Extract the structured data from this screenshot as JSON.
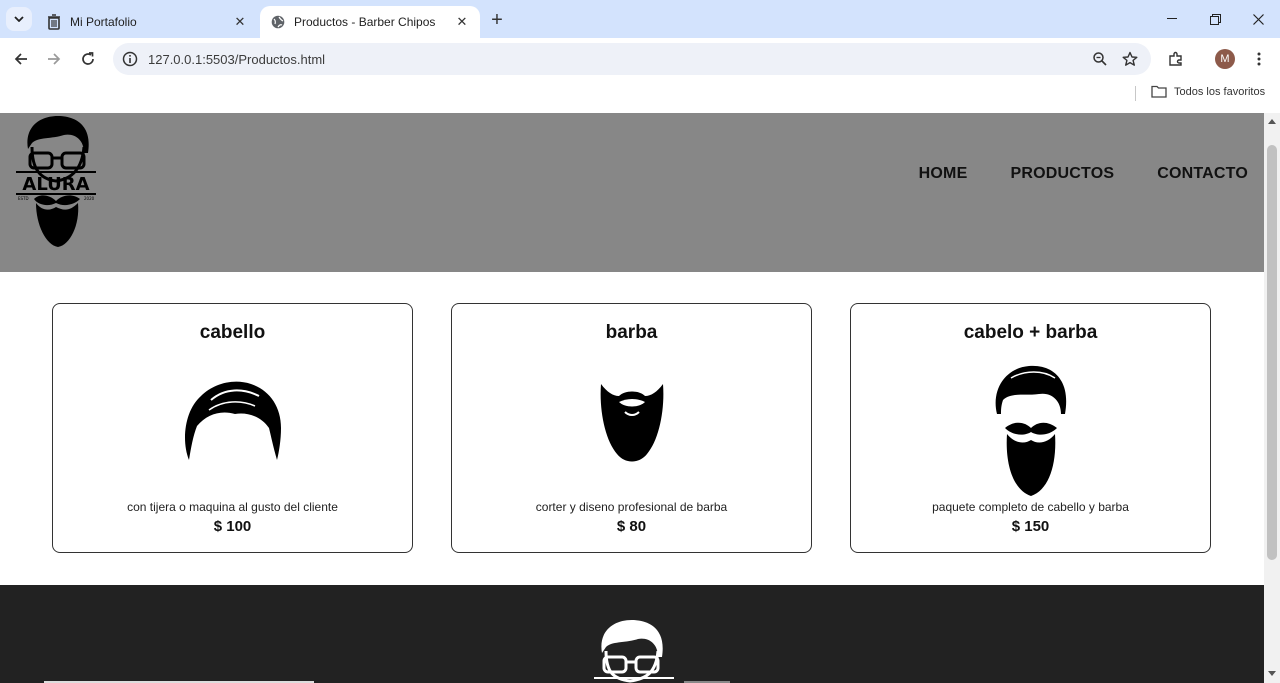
{
  "browser": {
    "tabs": [
      {
        "title": "Mi Portafolio",
        "active": false,
        "icon": "trash-icon"
      },
      {
        "title": "Productos - Barber Chipos",
        "active": true,
        "icon": "globe-icon"
      }
    ],
    "url": "127.0.0.1:5503/Productos.html",
    "profile_initial": "M",
    "bookmarks_label": "Todos los favoritos"
  },
  "site": {
    "logo_text": "ALURA",
    "nav": [
      {
        "label": "HOME"
      },
      {
        "label": "PRODUCTOS"
      },
      {
        "label": "CONTACTO"
      }
    ],
    "products": [
      {
        "title": "cabello",
        "description": "con tijera o maquina al gusto del cliente",
        "price": "$ 100",
        "icon": "hair-icon"
      },
      {
        "title": "barba",
        "description": "corter y diseno profesional de barba",
        "price": "$ 80",
        "icon": "beard-icon"
      },
      {
        "title": "cabelo + barba",
        "description": "paquete completo de cabello y barba",
        "price": "$ 150",
        "icon": "hair-and-beard-icon"
      }
    ]
  },
  "colors": {
    "header_bg": "#878787",
    "footer_bg": "#222222",
    "tabbar_bg": "#d3e3fd"
  }
}
